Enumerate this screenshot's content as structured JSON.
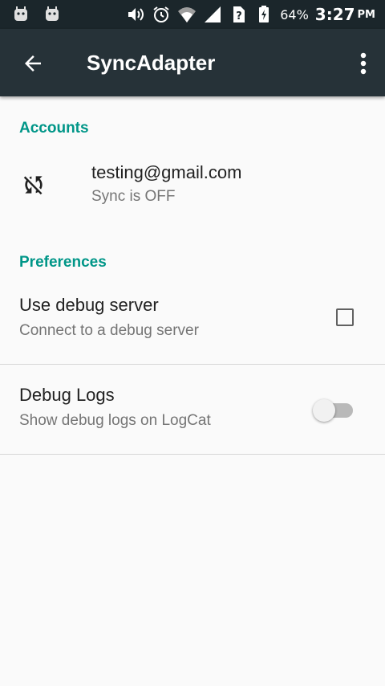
{
  "status_bar": {
    "battery": "64%",
    "time": "3:27",
    "ampm": "PM"
  },
  "app_bar": {
    "title": "SyncAdapter"
  },
  "accounts": {
    "header": "Accounts",
    "items": [
      {
        "email": "testing@gmail.com",
        "status": "Sync is OFF",
        "icon": "sync-disabled-icon"
      }
    ]
  },
  "preferences": {
    "header": "Preferences",
    "items": [
      {
        "title": "Use debug server",
        "summary": "Connect to a debug server",
        "control": "checkbox",
        "checked": false
      },
      {
        "title": "Debug Logs",
        "summary": "Show debug logs on LogCat",
        "control": "switch",
        "on": false
      }
    ]
  },
  "colors": {
    "accent": "#009688",
    "app_bar": "#263238",
    "status_bar": "#1b262b"
  }
}
